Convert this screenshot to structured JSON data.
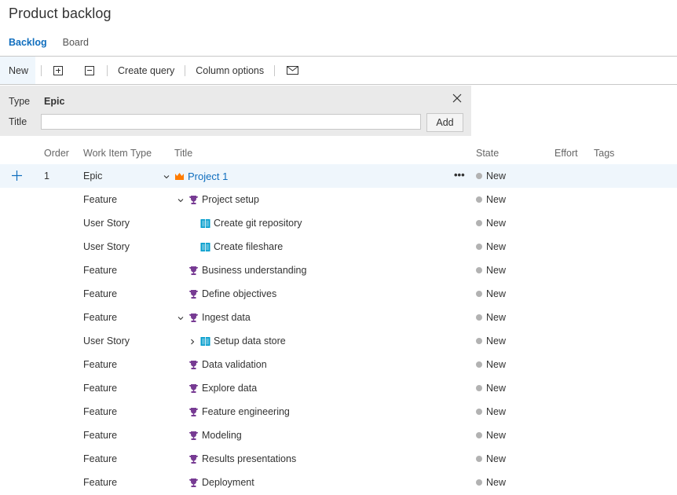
{
  "page": {
    "title": "Product backlog"
  },
  "pivots": [
    {
      "label": "Backlog",
      "active": true
    },
    {
      "label": "Board",
      "active": false
    }
  ],
  "toolbar": {
    "new_label": "New",
    "expand_icon": "expand-all-icon",
    "collapse_icon": "collapse-all-icon",
    "create_query_label": "Create query",
    "column_options_label": "Column options",
    "email_icon": "mail-icon"
  },
  "add_panel": {
    "type_label": "Type",
    "type_value": "Epic",
    "title_label": "Title",
    "title_value": "",
    "title_placeholder": "",
    "add_label": "Add"
  },
  "grid": {
    "columns": [
      "Order",
      "Work Item Type",
      "Title",
      "State",
      "Effort",
      "Tags"
    ],
    "state_color": "#b2b2b2",
    "rows": [
      {
        "order": "1",
        "type": "Epic",
        "title": "Project 1",
        "state": "New",
        "level": 0,
        "toggle": "expanded",
        "icon": "crown-icon",
        "selected": true
      },
      {
        "order": "",
        "type": "Feature",
        "title": "Project setup",
        "state": "New",
        "level": 1,
        "toggle": "expanded",
        "icon": "trophy-icon"
      },
      {
        "order": "",
        "type": "User Story",
        "title": "Create git repository",
        "state": "New",
        "level": 2,
        "toggle": "none",
        "icon": "book-icon"
      },
      {
        "order": "",
        "type": "User Story",
        "title": "Create fileshare",
        "state": "New",
        "level": 2,
        "toggle": "none",
        "icon": "book-icon"
      },
      {
        "order": "",
        "type": "Feature",
        "title": "Business understanding",
        "state": "New",
        "level": 1,
        "toggle": "none",
        "icon": "trophy-icon"
      },
      {
        "order": "",
        "type": "Feature",
        "title": "Define objectives",
        "state": "New",
        "level": 1,
        "toggle": "none",
        "icon": "trophy-icon"
      },
      {
        "order": "",
        "type": "Feature",
        "title": "Ingest data",
        "state": "New",
        "level": 1,
        "toggle": "expanded",
        "icon": "trophy-icon"
      },
      {
        "order": "",
        "type": "User Story",
        "title": "Setup data store",
        "state": "New",
        "level": 2,
        "toggle": "collapsed",
        "icon": "book-icon"
      },
      {
        "order": "",
        "type": "Feature",
        "title": "Data validation",
        "state": "New",
        "level": 1,
        "toggle": "none",
        "icon": "trophy-icon"
      },
      {
        "order": "",
        "type": "Feature",
        "title": "Explore data",
        "state": "New",
        "level": 1,
        "toggle": "none",
        "icon": "trophy-icon"
      },
      {
        "order": "",
        "type": "Feature",
        "title": "Feature engineering",
        "state": "New",
        "level": 1,
        "toggle": "none",
        "icon": "trophy-icon"
      },
      {
        "order": "",
        "type": "Feature",
        "title": "Modeling",
        "state": "New",
        "level": 1,
        "toggle": "none",
        "icon": "trophy-icon"
      },
      {
        "order": "",
        "type": "Feature",
        "title": "Results presentations",
        "state": "New",
        "level": 1,
        "toggle": "none",
        "icon": "trophy-icon"
      },
      {
        "order": "",
        "type": "Feature",
        "title": "Deployment",
        "state": "New",
        "level": 1,
        "toggle": "none",
        "icon": "trophy-icon"
      }
    ]
  },
  "colors": {
    "accent": "#106ebe",
    "epic": "#ff7b00",
    "feature": "#773b93",
    "user_story": "#009ccc",
    "selected_row": "#eff6fc"
  }
}
